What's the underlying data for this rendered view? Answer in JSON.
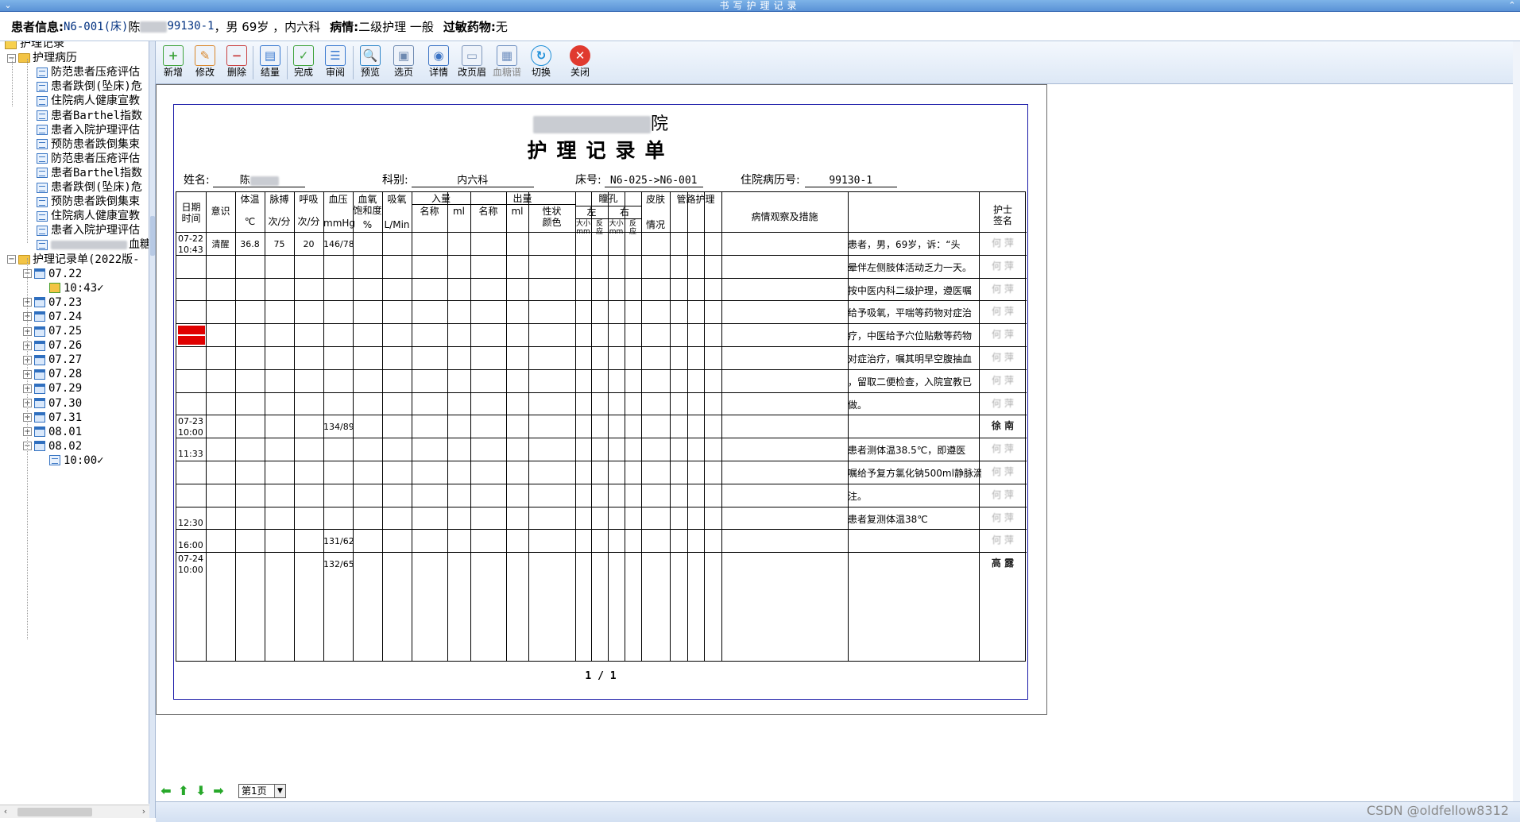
{
  "window": {
    "title": "书写护理记录"
  },
  "patient": {
    "label": "患者信息:",
    "bed": "N6-001(床)",
    "name_initial": "陈",
    "record_no": "99130-1",
    "sex_age": "，男 69岁 ，",
    "dept": "内六科",
    "condition_label": "病情:",
    "condition": "二级护理 一般",
    "allergy_label": "过敏药物:",
    "allergy": "无"
  },
  "tree": {
    "root": "护理记录",
    "case_group": "护理病历",
    "case_items": [
      "防范患者压疮评估",
      "患者跌倒(坠床)危",
      "住院病人健康宣教",
      "患者Barthel指数",
      "患者入院护理评估",
      "预防患者跌倒集束",
      "防范患者压疮评估",
      "患者Barthel指数",
      "患者跌倒(坠床)危",
      "预防患者跌倒集束",
      "住院病人健康宣教",
      "患者入院护理评估",
      "血糖"
    ],
    "record_group": "护理记录单(2022版-",
    "dates": [
      "07.22",
      "07.23",
      "07.24",
      "07.25",
      "07.26",
      "07.27",
      "07.28",
      "07.29",
      "07.30",
      "07.31",
      "08.01",
      "08.02"
    ],
    "times": {
      "d0722": "10:43✓",
      "d0802": "10:00✓"
    }
  },
  "toolbar": {
    "buttons": [
      {
        "label": "新增",
        "icon": "add-doc-icon"
      },
      {
        "label": "修改",
        "icon": "edit-doc-icon"
      },
      {
        "label": "删除",
        "icon": "delete-doc-icon"
      },
      {
        "label": "结量",
        "icon": "tally-icon"
      },
      {
        "label": "完成",
        "icon": "complete-icon"
      },
      {
        "label": "审阅",
        "icon": "review-icon"
      },
      {
        "label": "预览",
        "icon": "preview-icon"
      },
      {
        "label": "选页",
        "icon": "select-page-icon"
      },
      {
        "label": "详情",
        "icon": "details-icon"
      },
      {
        "label": "改页眉",
        "icon": "header-icon"
      },
      {
        "label": "血糖谱",
        "icon": "glucose-icon"
      },
      {
        "label": "切换",
        "icon": "switch-icon"
      },
      {
        "label": "关闭",
        "icon": "close-icon"
      }
    ]
  },
  "form": {
    "hospital": "院",
    "title": "护理记录单",
    "name_label": "姓名:",
    "name_value": "陈",
    "dept_label": "科别:",
    "dept_value": "内六科",
    "bed_label": "床号:",
    "bed_value": "N6-025->N6-001",
    "record_label": "住院病历号:",
    "record_value": "99130-1",
    "headers": {
      "date_time": "日期\n时间",
      "consciousness": "意识",
      "temp": "体温",
      "temp_unit": "℃",
      "pulse": "脉搏",
      "pulse_unit": "次/分",
      "resp": "呼吸",
      "resp_unit": "次/分",
      "bp": "血压",
      "bp_unit": "mmHg",
      "spo2": "血氧\n饱和度",
      "spo2_unit": "%",
      "oxygen": "吸氧",
      "oxygen_unit": "L/Min",
      "intake": "入量",
      "intake_name": "名称",
      "intake_ml": "ml",
      "output": "出量",
      "output_name": "名称",
      "output_ml": "ml",
      "output_color": "性状\n颜色",
      "pupil": "瞳孔",
      "pupil_left": "左",
      "pupil_right": "右",
      "pupil_size": "大小\nmm",
      "pupil_reflex": "反\n应",
      "skin": "皮肤",
      "skin_status": "情况",
      "tube": "管路护理",
      "observation": "病情观察及措施",
      "nurse_sign": "护士\n签名"
    },
    "rows": [
      {
        "date": "07-22",
        "time": "10:43",
        "consciousness": "清醒",
        "temp": "36.8",
        "pulse": "75",
        "resp": "20",
        "bp": "146/78",
        "obs": "  患者，男，69岁，诉：“头",
        "sign": "何 萍"
      },
      {
        "date": "",
        "time": "",
        "bp": "",
        "obs": "晕伴左侧肢体活动乏力一天。",
        "sign": "何 萍"
      },
      {
        "date": "",
        "time": "",
        "bp": "",
        "obs": "按中医内科二级护理，遵医嘱",
        "sign": "何 萍"
      },
      {
        "date": "",
        "time": "",
        "bp": "",
        "obs": "给予吸氧，平喘等药物对症治",
        "sign": "何 萍"
      },
      {
        "date": "",
        "time": "",
        "bp": "",
        "obs": "疗，中医给予穴位贴敷等药物",
        "sign": "何 萍"
      },
      {
        "date": "",
        "time": "",
        "bp": "",
        "obs": "对症治疗，嘱其明早空腹抽血",
        "sign": "何 萍"
      },
      {
        "date": "",
        "time": "",
        "bp": "",
        "obs": "，留取二便检查，入院宣教已",
        "sign": "何 萍"
      },
      {
        "date": "",
        "time": "",
        "bp": "",
        "obs": "做。",
        "sign": "何 萍"
      },
      {
        "date": "07-23",
        "time": "10:00",
        "bp": "134/89",
        "obs": "",
        "sign": "徐 南"
      },
      {
        "date": "",
        "time": "11:33",
        "bp": "",
        "obs": "  患者测体温38.5℃，即遵医",
        "sign": "何 萍"
      },
      {
        "date": "",
        "time": "",
        "bp": "",
        "obs": "嘱给予复方氯化钠500ml静脉滴",
        "sign": "何 萍"
      },
      {
        "date": "",
        "time": "",
        "bp": "",
        "obs": "注。",
        "sign": "何 萍"
      },
      {
        "date": "",
        "time": "12:30",
        "bp": "",
        "obs": " 患者复测体温38℃",
        "sign": "何 萍"
      },
      {
        "date": "",
        "time": "16:00",
        "bp": "131/62",
        "obs": "",
        "sign": "何 萍"
      },
      {
        "date": "07-24",
        "time": "10:00",
        "bp": "132/65",
        "obs": "",
        "sign": "高 露"
      }
    ],
    "page_indicator": "1 / 1"
  },
  "nav": {
    "page_select": "第1页"
  },
  "watermark": "CSDN @oldfellow8312",
  "colors": {
    "titlebar": "#5a92d6",
    "mark": "#e00000",
    "accent": "#1a1aa8"
  }
}
